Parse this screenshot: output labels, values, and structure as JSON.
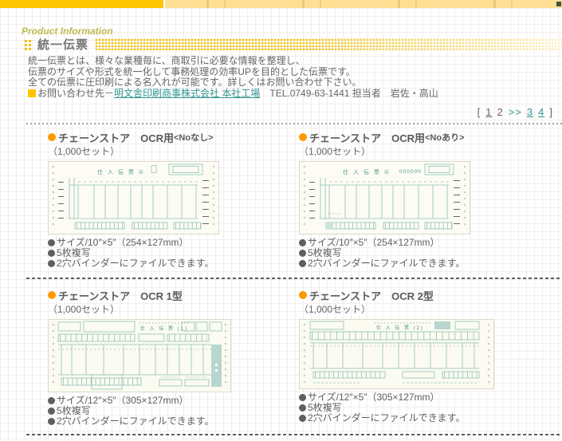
{
  "header": {
    "eyebrow": "Product Information",
    "title": "統一伝票"
  },
  "intro": {
    "line1": "統一伝票とは、様々な業種毎に、商取引に必要な情報を整理し、",
    "line2": "伝票のサイズや形式を統一化して事務処理の効率UPを目的とした伝票です。",
    "line3": "全ての伝票に圧印刷による名入れが可能です。詳しくはお問い合わせ下さい。",
    "contact_prefix": "お問い合わせ先－",
    "contact_link": "明文舎印刷商事株式会社 本社工場",
    "contact_suffix": "　TEL.0749-63-1441 担当者　岩佐・高山"
  },
  "pagination": {
    "open": "[",
    "page1": "1",
    "page2": "2",
    "next": ">>",
    "page3": "3",
    "page4": "4",
    "close": "]"
  },
  "products": [
    {
      "title": "チェーンストア　OCR用",
      "variant": "<Noなし>",
      "subtitle": "（1,000セット）",
      "form_label": "仕 入 伝 票 ①",
      "form_no": "",
      "spec1": "サイズ/10″×5″（254×127mm）",
      "spec2": "5枚複写",
      "spec3": "2穴バインダーにファイルできます。"
    },
    {
      "title": "チェーンストア　OCR用",
      "variant": "<Noあり>",
      "subtitle": "（1,000セット）",
      "form_label": "仕 入 伝 票 ①",
      "form_no": "000000",
      "spec1": "サイズ/10″×5″（254×127mm）",
      "spec2": "5枚複写",
      "spec3": "2穴バインダーにファイルできます。"
    },
    {
      "title": "チェーンストア　OCR 1型",
      "variant": "",
      "subtitle": "（1,000セット）",
      "form_label": "仕 入 伝 票 (1)",
      "form_no": "",
      "spec1": "サイズ/12″×5″（305×127mm）",
      "spec2": "5枚複写",
      "spec3": "2穴バインダーにファイルできます。"
    },
    {
      "title": "チェーンストア　OCR 2型",
      "variant": "",
      "subtitle": "（1,000セット）",
      "form_label": "仕 入 伝 票 (2)",
      "form_no": "",
      "spec1": "サイズ/12″×5″（305×127mm）",
      "spec2": "5枚複写",
      "spec3": "2穴バインダーにファイルできます。"
    }
  ],
  "colors": {
    "topbar_dark_yellow": "#ffc400",
    "topbar_light_yellow": "#ffdf94",
    "dots_yellow": "#f0c41a",
    "link_teal": "#2f9694",
    "bullet_orange": "#ff9900",
    "text_gray": "#666666",
    "form_teal": "#8fc0b6"
  }
}
